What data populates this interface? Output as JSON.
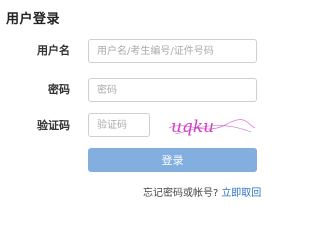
{
  "page_title": "用户登录",
  "username": {
    "label": "用户名",
    "placeholder": "用户名/考生编号/证件号码"
  },
  "password": {
    "label": "密码",
    "placeholder": "密码"
  },
  "captcha": {
    "label": "验证码",
    "placeholder": "验证码",
    "image_text": "uqku"
  },
  "login_button": "登录",
  "forgot": {
    "text": "忘记密码或帐号?",
    "link": "立即取回"
  },
  "colors": {
    "button": "#82aee0",
    "link": "#2e6fc9",
    "captcha_ink": "#d43fc6"
  }
}
